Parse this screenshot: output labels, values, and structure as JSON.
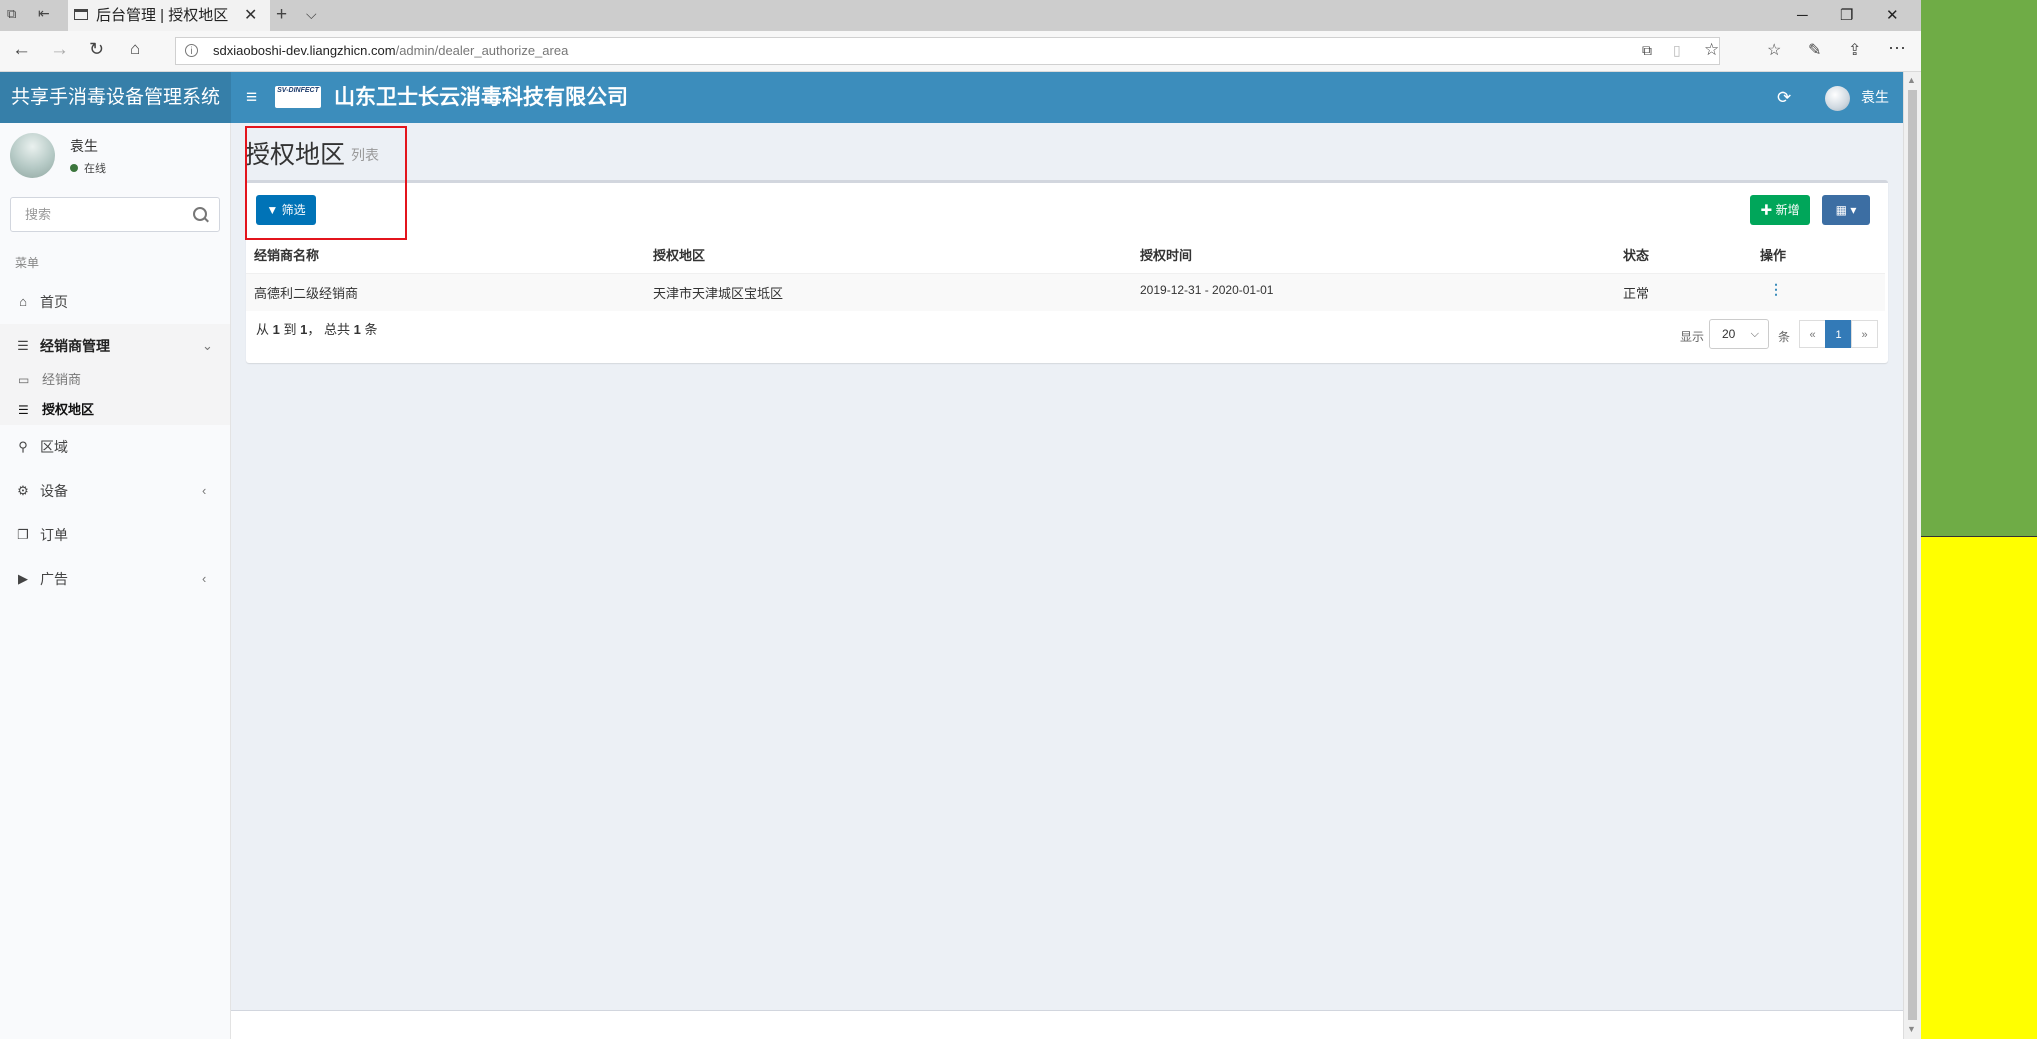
{
  "browser": {
    "tab_title": "后台管理 | 授权地区",
    "url_host": "sdxiaoboshi-dev.liangzhicn.com",
    "url_path": "/admin/dealer_authorize_area"
  },
  "app": {
    "system_name": "共享手消毒设备管理系统",
    "company_name": "山东卫士长云消毒科技有限公司",
    "logo_text": "SV-DINFECT",
    "user_name": "袁生"
  },
  "sidebar": {
    "user_name": "袁生",
    "status": "在线",
    "search_placeholder": "搜索",
    "menu_header": "菜单",
    "items": [
      {
        "label": "首页",
        "icon": "home-icon"
      },
      {
        "label": "经销商管理",
        "icon": "bars-icon"
      },
      {
        "label": "区域",
        "icon": "map-marker-icon"
      },
      {
        "label": "设备",
        "icon": "gear-icon"
      },
      {
        "label": "订单",
        "icon": "copy-icon"
      },
      {
        "label": "广告",
        "icon": "play-icon"
      }
    ],
    "sub_items": [
      {
        "label": "经销商",
        "icon": "inbox-icon"
      },
      {
        "label": "授权地区",
        "icon": "bars-icon"
      }
    ]
  },
  "page": {
    "title": "授权地区",
    "subtitle": "列表",
    "filter_label": "筛选",
    "add_label": "新增"
  },
  "table": {
    "headers": [
      "经销商名称",
      "授权地区",
      "授权时间",
      "状态",
      "操作"
    ],
    "rows": [
      [
        "高德利二级经销商",
        "天津市天津城区宝坻区",
        "2019-12-31 - 2020-01-01",
        "正常"
      ]
    ]
  },
  "pagination": {
    "from_prefix": "从",
    "from": "1",
    "to_prefix": "到",
    "to": "1",
    "total_prefix": "， 总共",
    "total": "1",
    "total_suffix": "条",
    "show_label": "显示",
    "page_size": "20",
    "per_label": "条",
    "prev": "«",
    "current": "1",
    "next": "»"
  },
  "colors": {
    "header": "#3c8dbc",
    "logo_bg": "#367fa9",
    "primary": "#0073b7",
    "success": "#00a65a",
    "highlight_box": "#e3141c"
  }
}
